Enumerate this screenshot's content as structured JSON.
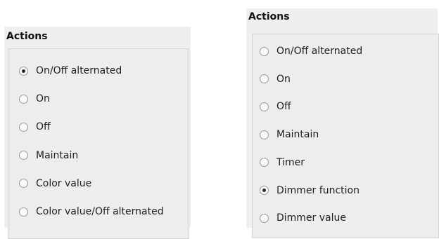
{
  "left_dialog": {
    "title": "Actions",
    "options": [
      {
        "label": "On/Off alternated",
        "checked": true
      },
      {
        "label": "On",
        "checked": false
      },
      {
        "label": "Off",
        "checked": false
      },
      {
        "label": "Maintain",
        "checked": false
      },
      {
        "label": "Color value",
        "checked": false
      },
      {
        "label": "Color value/Off alternated",
        "checked": false
      }
    ]
  },
  "right_dialog": {
    "title": "Actions",
    "options": [
      {
        "label": "On/Off alternated",
        "checked": false
      },
      {
        "label": "On",
        "checked": false
      },
      {
        "label": "Off",
        "checked": false
      },
      {
        "label": "Maintain",
        "checked": false
      },
      {
        "label": "Timer",
        "checked": false
      },
      {
        "label": "Dimmer function",
        "checked": true
      },
      {
        "label": "Dimmer value",
        "checked": false
      }
    ]
  }
}
